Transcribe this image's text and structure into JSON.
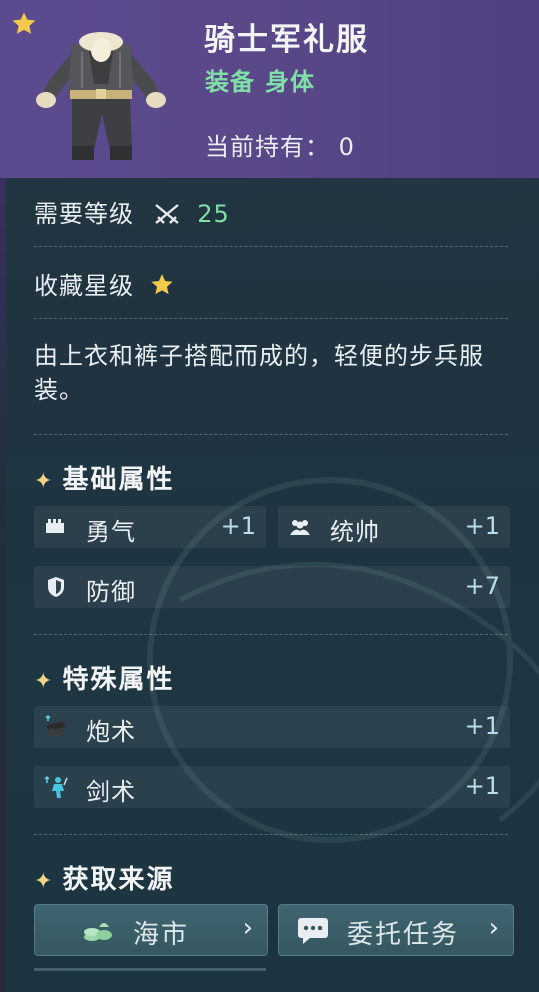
{
  "item": {
    "title": "骑士军礼服",
    "type": "装备",
    "slot": "身体",
    "owned_label": "当前持有：",
    "owned_count": "0",
    "level_label": "需要等级",
    "level_value": "25",
    "star_label": "收藏星级",
    "stars": 1,
    "description": "由上衣和裤子搭配而成的，轻便的步兵服装。"
  },
  "base_section": {
    "title": "基础属性",
    "stats": [
      {
        "label": "勇气",
        "value": "+1",
        "icon": "courage-icon"
      },
      {
        "label": "统帅",
        "value": "+1",
        "icon": "command-icon"
      },
      {
        "label": "防御",
        "value": "+7",
        "icon": "shield-icon"
      }
    ]
  },
  "special_section": {
    "title": "特殊属性",
    "stats": [
      {
        "label": "炮术",
        "value": "+1",
        "icon": "cannon-icon"
      },
      {
        "label": "剑术",
        "value": "+1",
        "icon": "swordsman-icon"
      }
    ]
  },
  "source_section": {
    "title": "获取来源",
    "buttons": [
      {
        "label": "海市",
        "icon": "coins-icon"
      },
      {
        "label": "委托任务",
        "icon": "chat-bubble-icon"
      }
    ]
  },
  "colors": {
    "header_bg": "#5a4889",
    "accent_green": "#7fe0a8",
    "star_gold": "#f2c94c",
    "panel_bg": "#1f3440",
    "stat_value": "#b9dcef"
  }
}
